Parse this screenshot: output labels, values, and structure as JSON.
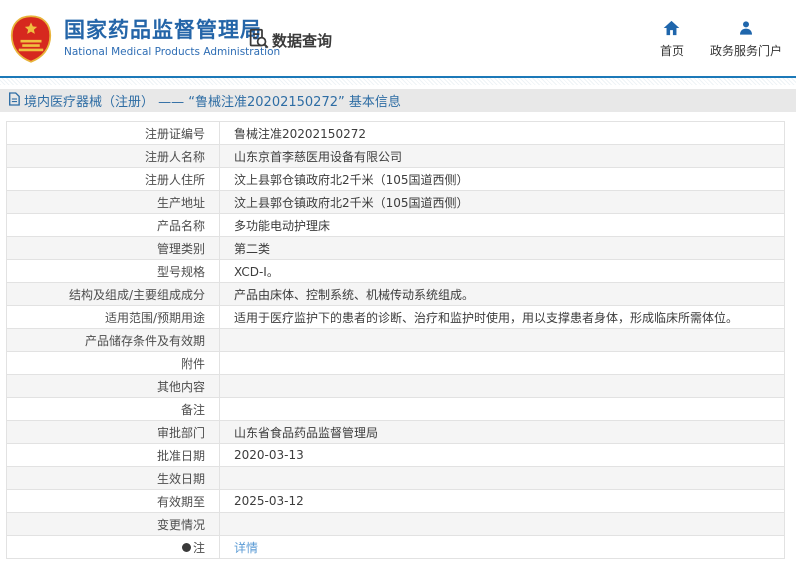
{
  "header": {
    "title_cn": "国家药品监督管理局",
    "title_en": "National Medical Products Administration",
    "section_label": "数据查询",
    "nav": [
      {
        "icon": "home-icon",
        "label": "首页"
      },
      {
        "icon": "user-icon",
        "label": "政务服务门户"
      }
    ]
  },
  "breadcrumb": {
    "icon": "document-icon",
    "text": "境内医疗器械（注册） —— “鲁械注准20202150272” 基本信息"
  },
  "table": {
    "rows": [
      {
        "label": "注册证编号",
        "value": "鲁械注准20202150272"
      },
      {
        "label": "注册人名称",
        "value": "山东京首李慈医用设备有限公司"
      },
      {
        "label": "注册人住所",
        "value": "汶上县郭仓镇政府北2千米（105国道西侧）"
      },
      {
        "label": "生产地址",
        "value": "汶上县郭仓镇政府北2千米（105国道西侧）"
      },
      {
        "label": "产品名称",
        "value": "多功能电动护理床"
      },
      {
        "label": "管理类别",
        "value": "第二类"
      },
      {
        "label": "型号规格",
        "value": "XCD-I。"
      },
      {
        "label": "结构及组成/主要组成成分",
        "value": "产品由床体、控制系统、机械传动系统组成。"
      },
      {
        "label": "适用范围/预期用途",
        "value": "适用于医疗监护下的患者的诊断、治疗和监护时使用，用以支撑患者身体，形成临床所需体位。"
      },
      {
        "label": "产品储存条件及有效期",
        "value": ""
      },
      {
        "label": "附件",
        "value": ""
      },
      {
        "label": "其他内容",
        "value": ""
      },
      {
        "label": "备注",
        "value": ""
      },
      {
        "label": "审批部门",
        "value": "山东省食品药品监督管理局"
      },
      {
        "label": "批准日期",
        "value": "2020-03-13"
      },
      {
        "label": "生效日期",
        "value": ""
      },
      {
        "label": "有效期至",
        "value": "2025-03-12"
      },
      {
        "label": "变更情况",
        "value": ""
      },
      {
        "label": "注",
        "value": "详情",
        "link": true,
        "label_icon": "note-icon"
      }
    ]
  },
  "colors": {
    "accent_blue": "#2465a8",
    "header_line": "#1c79b8",
    "breadcrumb_bg": "#e8e8e8",
    "breadcrumb_text": "#2e6da4",
    "zebra_row": "#f5f5f5",
    "link": "#5b9bd5",
    "emblem_red": "#d6281e",
    "emblem_gold": "#f0c040"
  }
}
